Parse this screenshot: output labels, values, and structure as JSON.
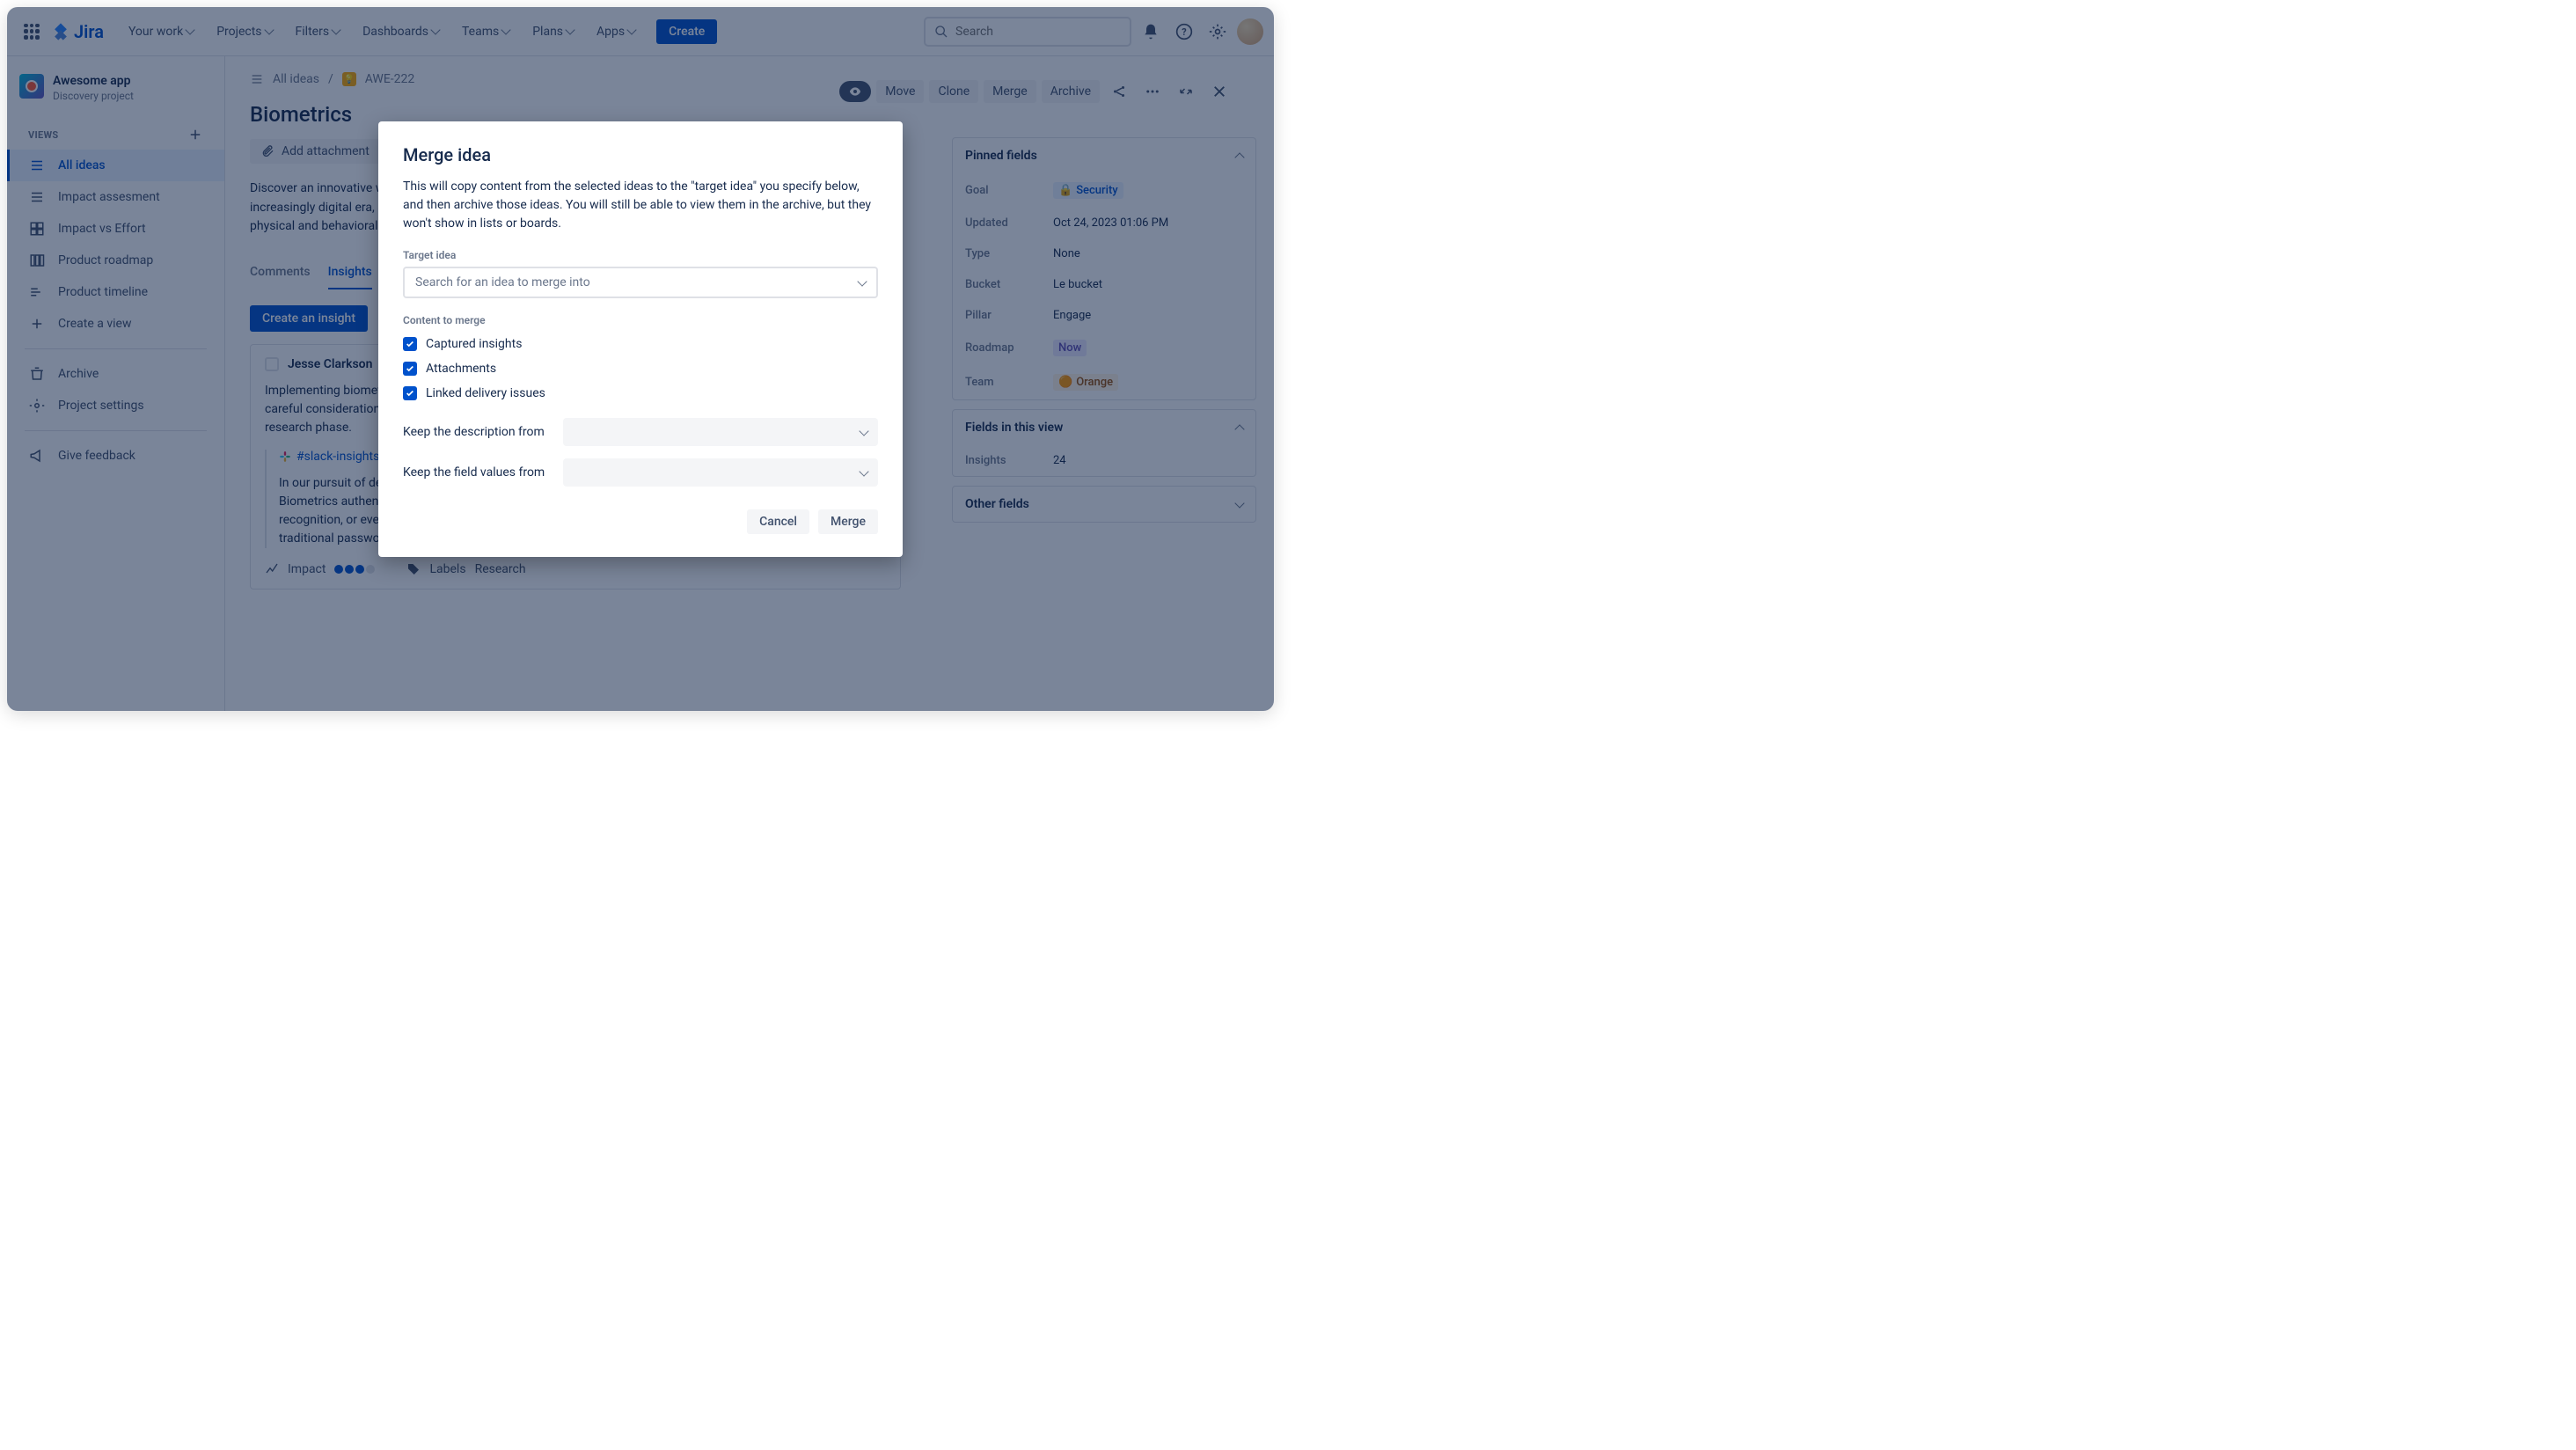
{
  "topnav": {
    "logo": "Jira",
    "items": [
      "Your work",
      "Projects",
      "Filters",
      "Dashboards",
      "Teams",
      "Plans",
      "Apps"
    ],
    "create": "Create",
    "search_placeholder": "Search"
  },
  "project": {
    "name": "Awesome app",
    "type": "Discovery project"
  },
  "sidebar": {
    "section_views": "VIEWS",
    "items": [
      "All ideas",
      "Impact assesment",
      "Impact vs Effort",
      "Product roadmap",
      "Product timeline",
      "Create a view"
    ],
    "archive": "Archive",
    "settings": "Project settings",
    "feedback": "Give feedback"
  },
  "breadcrumb": {
    "all_ideas": "All ideas",
    "issue_key": "AWE-222"
  },
  "actions": {
    "move": "Move",
    "clone": "Clone",
    "merge": "Merge",
    "archive": "Archive"
  },
  "page": {
    "title": "Biometrics",
    "add_attachment": "Add attachment",
    "description": "Discover an innovative way to safeguard your digital world with our Biometrics Authentication feature. In our increasingly digital era, security is paramount, and that's why we've developed a robust solution based on unique physical and behavioral characteristics. Whether it's your fingerprint, facial recognition, voice identification...",
    "tabs": {
      "comments": "Comments",
      "insights": "Insights"
    },
    "create_insight": "Create an insight"
  },
  "insight": {
    "author": "Jesse Clarkson",
    "body": "Implementing biometrics authentication is driven by a strong desire to enhance user security. However, it requires careful consideration of user privacy and data protection. This initiative is currently in the exploration and research phase.",
    "slack_channel": "#slack-insights",
    "quote": "In our pursuit of developing Biometrics Authentication, we have encountered a fascinating challenge. Biometrics authentication, which uses unique physical or behavioral attributes like fingerprints, facial recognition, or even voice patterns for identification, offers a high level of security and convenience that traditional passwords or PINs cannot match.",
    "impact_label": "Impact",
    "labels_label": "Labels",
    "labels_value": "Research"
  },
  "pinned": {
    "header": "Pinned fields",
    "rows": {
      "goal_label": "Goal",
      "goal_value": "Security",
      "updated_label": "Updated",
      "updated_value": "Oct 24, 2023 01:06 PM",
      "type_label": "Type",
      "type_value": "None",
      "bucket_label": "Bucket",
      "bucket_value": "Le bucket",
      "pillar_label": "Pillar",
      "pillar_value": "Engage",
      "roadmap_label": "Roadmap",
      "roadmap_value": "Now",
      "team_label": "Team",
      "team_value": "Orange"
    }
  },
  "fields_in_view": {
    "header": "Fields in this view",
    "insights_label": "Insights",
    "insights_value": "24"
  },
  "other_fields": {
    "header": "Other fields"
  },
  "modal": {
    "title": "Merge idea",
    "description": "This will copy content from the selected ideas to the \"target idea\" you specify below, and then archive those ideas. You will still be able to view them in the archive, but they won't show in lists or boards.",
    "target_label": "Target idea",
    "target_placeholder": "Search for an idea to merge into",
    "content_label": "Content to merge",
    "checks": {
      "insights": "Captured insights",
      "attachments": "Attachments",
      "linked": "Linked delivery issues"
    },
    "keep_desc": "Keep the description from",
    "keep_fields": "Keep the field values from",
    "cancel": "Cancel",
    "merge": "Merge"
  }
}
